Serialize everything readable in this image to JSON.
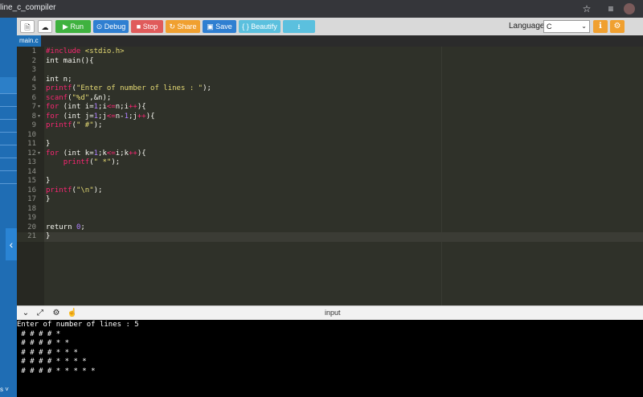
{
  "browser": {
    "url_fragment": "line_c_compiler",
    "icons": [
      "star-icon",
      "playlist-icon",
      "profile-avatar"
    ]
  },
  "sidebar": {
    "collapse_glyph": "‹",
    "bottom_text": "s ˅"
  },
  "toolbar": {
    "new_file_label": "",
    "upload_label": "",
    "run_label": "Run",
    "debug_label": "Debug",
    "stop_label": "Stop",
    "share_label": "Share",
    "save_label": "Save",
    "beautify_label": "{ } Beautify",
    "download_label": "",
    "language_label": "Language",
    "language_value": "C",
    "colors": {
      "run": "#3fb23f",
      "debug": "#2f7fd1",
      "stop": "#e05b5b",
      "share": "#f0a030",
      "save": "#2f7fd1",
      "beautify": "#5bc0de",
      "download": "#5bc0de"
    }
  },
  "editor": {
    "file_tab": "main.c",
    "lines": [
      "#include <stdio.h>",
      "int main(){",
      "",
      "int n;",
      "printf(\"Enter of number of lines : \");",
      "scanf(\"%d\",&n);",
      "for (int i=1;i<=n;i++){",
      "for (int j=1;j<=n-1;j++){",
      "printf(\" #\");",
      "",
      "}",
      "for (int k=1;k<=i;k++){",
      "    printf(\" *\");",
      "",
      "}",
      "printf(\"\\n\");",
      "}",
      "",
      "",
      "return 0;",
      "}"
    ],
    "line_numbers": [
      "1",
      "2",
      "3",
      "4",
      "5",
      "6",
      "7",
      "8",
      "9",
      "10",
      "11",
      "12",
      "13",
      "14",
      "15",
      "16",
      "17",
      "18",
      "19",
      "20",
      "21"
    ],
    "active_line": 21
  },
  "io": {
    "title": "input",
    "output_lines": [
      "Enter of number of lines : 5",
      " # # # # *",
      " # # # # * *",
      " # # # # * * *",
      " # # # # * * * *",
      " # # # # * * * * *"
    ]
  }
}
